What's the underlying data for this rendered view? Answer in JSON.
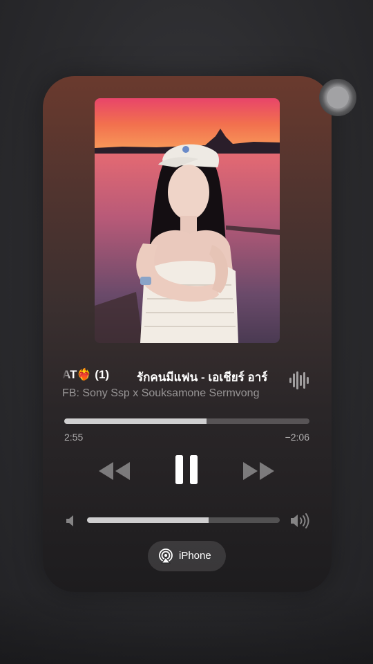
{
  "now_playing": {
    "title_prefix": "AT❤️‍🔥 (1)",
    "title": "รักคนมีแฟน - เอเชียร์ อาร์",
    "artist": "FB: Sony Ssp x Souksamone Sermvong"
  },
  "playback": {
    "elapsed": "2:55",
    "remaining": "−2:06",
    "progress": 0.58,
    "state": "playing"
  },
  "volume": {
    "level": 0.63
  },
  "output_device": {
    "label": "iPhone"
  },
  "icons": {
    "rewind": "rewind-icon",
    "pause": "pause-icon",
    "fast_forward": "fast-forward-icon",
    "volume_low": "speaker-low-icon",
    "volume_high": "speaker-high-icon",
    "airplay": "airplay-icon",
    "waveform": "waveform-icon",
    "assistive_touch": "assistive-touch-icon"
  }
}
